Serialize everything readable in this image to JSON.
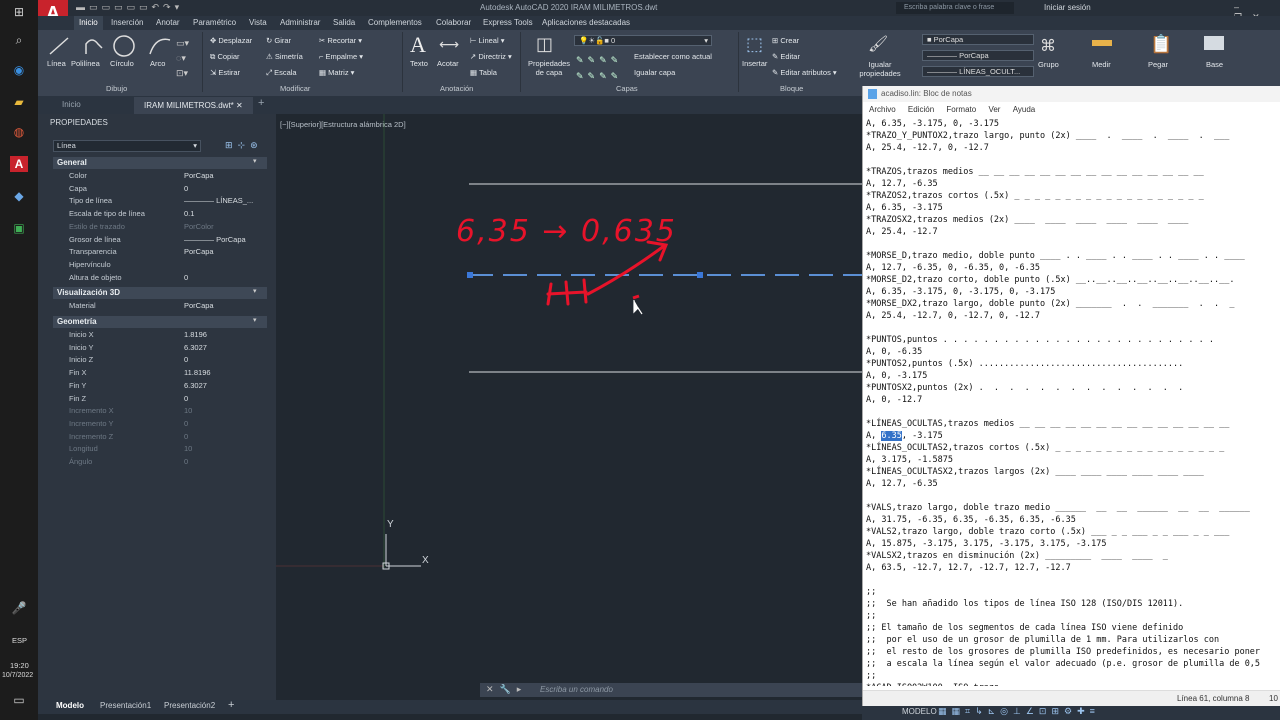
{
  "app": {
    "title": "Autodesk AutoCAD 2020   IRAM MILIMETROS.dwt",
    "search_placeholder": "Escriba palabra clave o frase",
    "login": "Iniciar sesión"
  },
  "ribbon_tabs": [
    "Inicio",
    "Inserción",
    "Anotar",
    "Paramétrico",
    "Vista",
    "Administrar",
    "Salida",
    "Complementos",
    "Colaborar",
    "Express Tools",
    "Aplicaciones destacadas"
  ],
  "ribbon": {
    "draw": [
      "Línea",
      "Polilínea",
      "Círculo",
      "Arco"
    ],
    "modify": [
      "Desplazar",
      "Girar",
      "Recortar",
      "Copiar",
      "Simetría",
      "Empalme",
      "Estirar",
      "Escala",
      "Matriz"
    ],
    "annotation": [
      "Texto",
      "Acotar",
      "Lineal",
      "Directriz",
      "Tabla"
    ],
    "layers": [
      "Propiedades de capa",
      "Establecer como actual",
      "Igualar capa"
    ],
    "layer_value": "0",
    "insert": [
      "Insertar",
      "Crear",
      "Editar",
      "Editar atributos"
    ],
    "props": [
      "Igualar propiedades",
      "PorCapa",
      "PorCapa",
      "LÍNEAS_OCULT..."
    ],
    "groups": [
      "Grupo",
      "Medir",
      "Pegar",
      "Base"
    ],
    "group_labels": [
      "Dibujo",
      "Modificar",
      "Anotación",
      "Capas",
      "Bloque"
    ]
  },
  "doc_tabs": [
    "Inicio",
    "IRAM MILIMETROS.dwt*"
  ],
  "properties": {
    "header": "PROPIEDADES",
    "selected": "Línea",
    "sections": [
      {
        "title": "General",
        "rows": [
          {
            "k": "Color",
            "v": "PorCapa"
          },
          {
            "k": "Capa",
            "v": "0"
          },
          {
            "k": "Tipo de línea",
            "v": "———— LÍNEAS_..."
          },
          {
            "k": "Escala de tipo de línea",
            "v": "0.1"
          },
          {
            "k": "Estilo de trazado",
            "v": "PorColor",
            "dim": true
          },
          {
            "k": "Grosor de línea",
            "v": "———— PorCapa"
          },
          {
            "k": "Transparencia",
            "v": "PorCapa"
          },
          {
            "k": "Hipervínculo",
            "v": ""
          },
          {
            "k": "Altura de objeto",
            "v": "0"
          }
        ]
      },
      {
        "title": "Visualización 3D",
        "rows": [
          {
            "k": "Material",
            "v": "PorCapa"
          }
        ]
      },
      {
        "title": "Geometría",
        "rows": [
          {
            "k": "Inicio X",
            "v": "1.8196"
          },
          {
            "k": "Inicio Y",
            "v": "6.3027"
          },
          {
            "k": "Inicio Z",
            "v": "0"
          },
          {
            "k": "Fin X",
            "v": "11.8196"
          },
          {
            "k": "Fin Y",
            "v": "6.3027"
          },
          {
            "k": "Fin Z",
            "v": "0"
          },
          {
            "k": "Incremento X",
            "v": "10",
            "dim": true
          },
          {
            "k": "Incremento Y",
            "v": "0",
            "dim": true
          },
          {
            "k": "Incremento Z",
            "v": "0",
            "dim": true
          },
          {
            "k": "Longitud",
            "v": "10",
            "dim": true
          },
          {
            "k": "Ángulo",
            "v": "0",
            "dim": true
          }
        ]
      }
    ]
  },
  "canvas": {
    "viewport_label": "[−][Superior][Estructura alámbrica 2D]",
    "annotation": "6,35 → 0,635",
    "ucs_x": "X",
    "ucs_y": "Y"
  },
  "notepad": {
    "title": "acadiso.lin: Bloc de notas",
    "menu": [
      "Archivo",
      "Edición",
      "Formato",
      "Ver",
      "Ayuda"
    ],
    "lines": [
      "A, 6.35, -3.175, 0, -3.175",
      "*TRAZO_Y_PUNTOX2,trazo largo, punto (2x) ____  .  ____  .  ____  .  ___",
      "A, 25.4, -12.7, 0, -12.7",
      "",
      "*TRAZOS,trazos medios __ __ __ __ __ __ __ __ __ __ __ __ __ __ __",
      "A, 12.7, -6.35",
      "*TRAZOS2,trazos cortos (.5x) _ _ _ _ _ _ _ _ _ _ _ _ _ _ _ _ _ _ _",
      "A, 6.35, -3.175",
      "*TRAZOSX2,trazos medios (2x) ____  ____  ____  ____  ____  ____",
      "A, 25.4, -12.7",
      "",
      "*MORSE_D,trazo medio, doble punto ____ . . ____ . . ____ . . ____ . . ____",
      "A, 12.7, -6.35, 0, -6.35, 0, -6.35",
      "*MORSE_D2,trazo corto, doble punto (.5x) __..__..__..__..__..__..__..__.",
      "A, 6.35, -3.175, 0, -3.175, 0, -3.175",
      "*MORSE_DX2,trazo largo, doble punto (2x) _______  .  .  _______  .  .  _",
      "A, 25.4, -12.7, 0, -12.7, 0, -12.7",
      "",
      "*PUNTOS,puntos . . . . . . . . . . . . . . . . . . . . . . . . . . .",
      "A, 0, -6.35",
      "*PUNTOS2,puntos (.5x) ........................................",
      "A, 0, -3.175",
      "*PUNTOSX2,puntos (2x) .  .  .  .  .  .  .  .  .  .  .  .  .  .",
      "A, 0, -12.7",
      "",
      "*LÍNEAS_OCULTAS,trazos medios __ __ __ __ __ __ __ __ __ __ __ __ __ __",
      "A, {{HL}}, -3.175",
      "*LÍNEAS_OCULTAS2,trazos cortos (.5x) _ _ _ _ _ _ _ _ _ _ _ _ _ _ _ _ _",
      "A, 3.175, -1.5875",
      "*LÍNEAS_OCULTASX2,trazos largos (2x) ____ ____ ____ ____ ____ ____",
      "A, 12.7, -6.35",
      "",
      "*VALS,trazo largo, doble trazo medio ______  __  __  ______  __  __  ______",
      "A, 31.75, -6.35, 6.35, -6.35, 6.35, -6.35",
      "*VALS2,trazo largo, doble trazo corto (.5x) ___ _ _ ___ _ _ ___ _ _ ___",
      "A, 15.875, -3.175, 3.175, -3.175, 3.175, -3.175",
      "*VALSX2,trazos en disminución (2x) _________  ____  ____  _",
      "A, 63.5, -12.7, 12.7, -12.7, 12.7, -12.7",
      "",
      ";;",
      ";;  Se han añadido los tipos de línea ISO 128 (ISO/DIS 12011).",
      ";;",
      ";; El tamaño de los segmentos de cada línea ISO viene definido",
      ";;  por el uso de un grosor de plumilla de 1 mm. Para utilizarlos con",
      ";;  el resto de los grosores de plumilla ISO predefinidos, es necesario poner",
      ";;  a escala la línea según el valor adecuado (p.e. grosor de plumilla de 0,5",
      ";;",
      "*ACAD_ISO02W100, ISO trazo"
    ],
    "highlight": "6.35",
    "status": "Línea 61, columna 8",
    "zoom": "10"
  },
  "command_placeholder": "Escriba un comando",
  "layout_tabs": [
    "Modelo",
    "Presentación1",
    "Presentación2"
  ],
  "status_model": "MODELO",
  "taskbar": {
    "lang": "ESP",
    "time": "19:20",
    "date": "10/7/2022"
  }
}
